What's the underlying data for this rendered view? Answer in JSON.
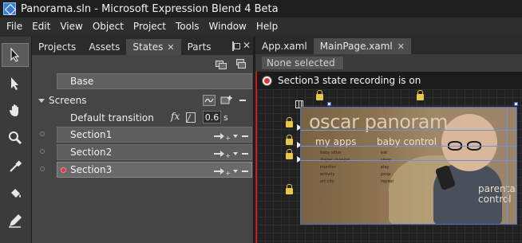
{
  "window": {
    "title": "Panorama.sln - Microsoft Expression Blend 4 Beta"
  },
  "menu": [
    "File",
    "Edit",
    "View",
    "Object",
    "Project",
    "Tools",
    "Window",
    "Help"
  ],
  "panel_tabs": [
    {
      "label": "Projects"
    },
    {
      "label": "Assets"
    },
    {
      "label": "States",
      "close": "✕"
    },
    {
      "label": "Parts"
    }
  ],
  "panel_close": "✕",
  "states": {
    "base_label": "Base",
    "group_label": "Screens",
    "default_transition_label": "Default transition",
    "fx_label": "fx",
    "duration_value": "0.6",
    "duration_unit": "s",
    "rows": [
      {
        "label": "Section1",
        "recording": false
      },
      {
        "label": "Section2",
        "recording": false
      },
      {
        "label": "Section3",
        "recording": true
      }
    ]
  },
  "doc_tabs": [
    {
      "label": "App.xaml"
    },
    {
      "label": "MainPage.xaml",
      "close": "✕"
    }
  ],
  "doc_toolbar": {
    "selection": "None selected"
  },
  "recording_banner": "Section3 state recording is on",
  "design": {
    "title": "oscar panoram",
    "col1": "my apps",
    "col2": "baby control",
    "parental_line1": "parental",
    "parental_line2": "control",
    "list_left": [
      "baby sitter",
      "diaper changer",
      "monitor",
      "activity",
      "art city"
    ],
    "list_right": [
      "eat",
      "sleep",
      "play",
      "poop",
      "repeat"
    ]
  },
  "colors": {
    "recording_red": "#c21d22",
    "guide_blue": "#6f93e0",
    "lock_yellow": "#e8c84a"
  }
}
